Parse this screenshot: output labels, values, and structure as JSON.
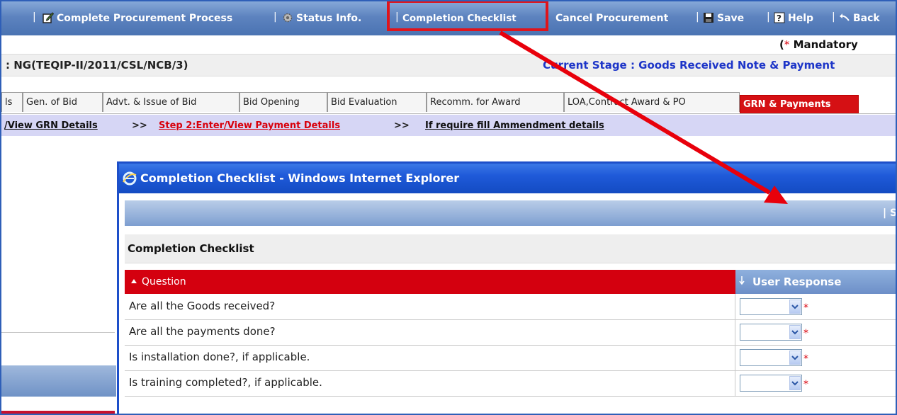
{
  "toolbar": {
    "complete_process": "Complete Procurement Process",
    "status_info": "Status Info.",
    "completion_checklist": "Completion Checklist",
    "cancel_procurement": "Cancel Procurement",
    "save": "Save",
    "help": "Help",
    "back": "Back",
    "separator": "|"
  },
  "mandatory": {
    "prefix": "(",
    "star": "*",
    "text": " Mandatory"
  },
  "reference": {
    "number": ": NG(TEQIP-II/2011/CSL/NCB/3)",
    "current_stage": "Current Stage : Goods Received Note & Payment"
  },
  "tabs": [
    {
      "label": "ls"
    },
    {
      "label": "Gen. of Bid"
    },
    {
      "label": "Advt. & Issue of Bid"
    },
    {
      "label": "Bid Opening"
    },
    {
      "label": "Bid Evaluation"
    },
    {
      "label": "Recomm. for Award"
    },
    {
      "label": "LOA,Contract Award & PO"
    },
    {
      "label": "GRN & Payments"
    }
  ],
  "steps": {
    "step1": "/View GRN Details",
    "sep": ">>",
    "step2": "Step 2:Enter/View Payment Details",
    "step3": "If require fill Ammendment details"
  },
  "popup": {
    "title": "Completion Checklist - Windows Internet Explorer",
    "save": "| Save  |",
    "heading": "Completion Checklist",
    "col_question": "Question",
    "col_response": "User Response",
    "rows": [
      {
        "question": "Are all the Goods received?",
        "response": ""
      },
      {
        "question": "Are all the payments done?",
        "response": ""
      },
      {
        "question": "Is installation done?, if applicable.",
        "response": ""
      },
      {
        "question": "Is training completed?, if applicable.",
        "response": ""
      }
    ],
    "required_mark": "*"
  },
  "colors": {
    "accent_red": "#d51014",
    "header_blue": "#4a73b2",
    "ie_title_blue": "#1f5ad9",
    "stage_blue": "#1d35c8"
  },
  "icons": [
    "edit-icon",
    "gear-icon",
    "save-icon",
    "help-icon",
    "back-icon",
    "ie-icon",
    "sort-up-icon",
    "sort-down-icon",
    "chevron-down-icon"
  ]
}
